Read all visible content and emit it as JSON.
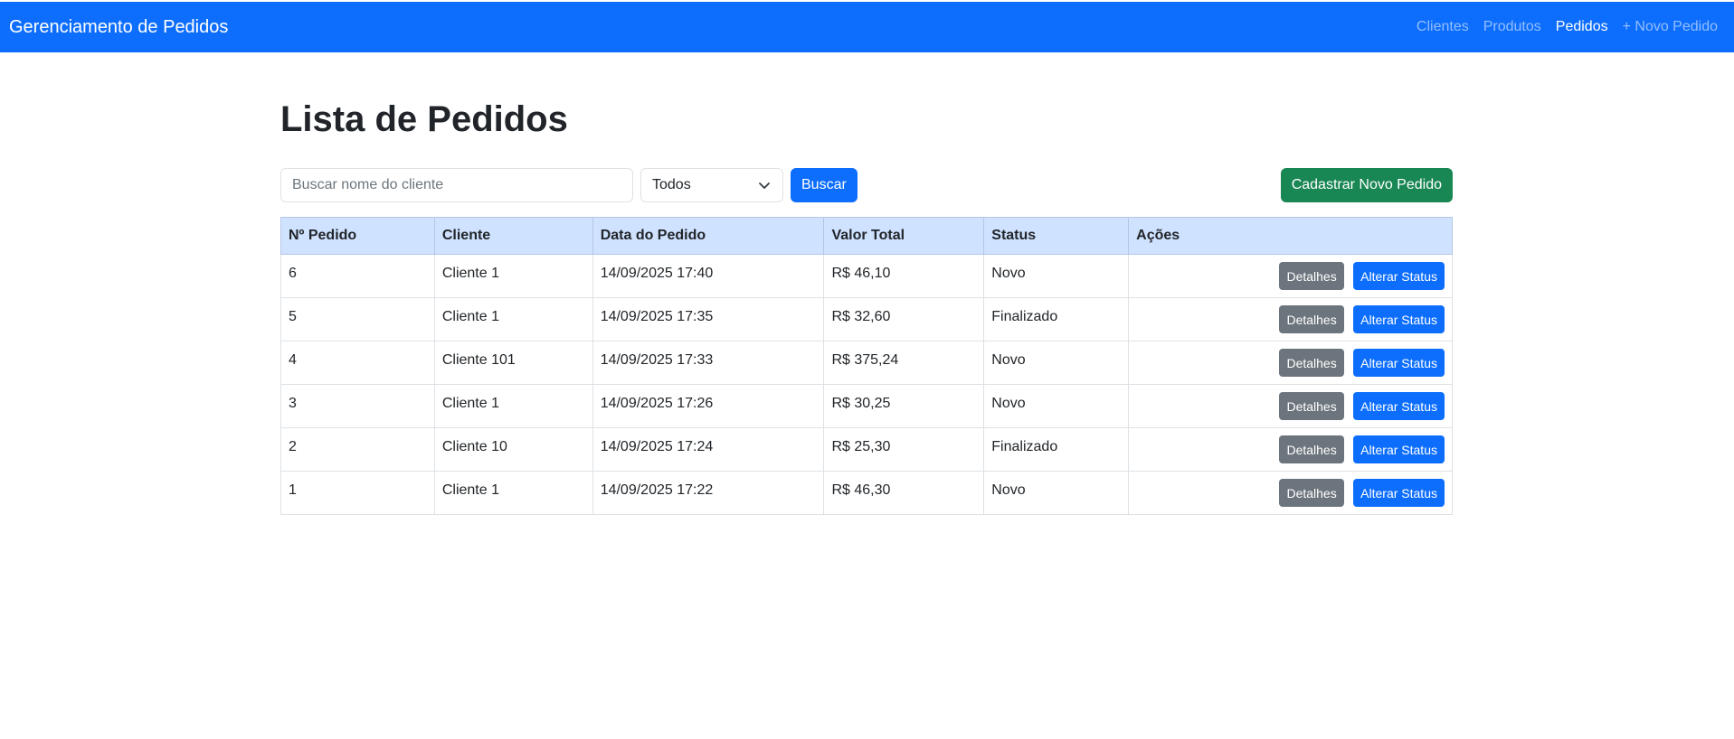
{
  "navbar": {
    "brand": "Gerenciamento de Pedidos",
    "links": [
      {
        "label": "Clientes",
        "active": false
      },
      {
        "label": "Produtos",
        "active": false
      },
      {
        "label": "Pedidos",
        "active": true
      },
      {
        "label": "+ Novo Pedido",
        "active": false
      }
    ]
  },
  "page": {
    "title": "Lista de Pedidos"
  },
  "toolbar": {
    "search_placeholder": "Buscar nome do cliente",
    "search_value": "",
    "status_filter": "Todos",
    "search_button": "Buscar",
    "new_order_button": "Cadastrar Novo Pedido"
  },
  "table": {
    "headers": [
      "Nº Pedido",
      "Cliente",
      "Data do Pedido",
      "Valor Total",
      "Status",
      "Ações"
    ],
    "rows": [
      {
        "id": "6",
        "client": "Cliente 1",
        "date": "14/09/2025 17:40",
        "total": "R$ 46,10",
        "status": "Novo"
      },
      {
        "id": "5",
        "client": "Cliente 1",
        "date": "14/09/2025 17:35",
        "total": "R$ 32,60",
        "status": "Finalizado"
      },
      {
        "id": "4",
        "client": "Cliente 101",
        "date": "14/09/2025 17:33",
        "total": "R$ 375,24",
        "status": "Novo"
      },
      {
        "id": "3",
        "client": "Cliente 1",
        "date": "14/09/2025 17:26",
        "total": "R$ 30,25",
        "status": "Novo"
      },
      {
        "id": "2",
        "client": "Cliente 10",
        "date": "14/09/2025 17:24",
        "total": "R$ 25,30",
        "status": "Finalizado"
      },
      {
        "id": "1",
        "client": "Cliente 1",
        "date": "14/09/2025 17:22",
        "total": "R$ 46,30",
        "status": "Novo"
      }
    ],
    "details_label": "Detalhes",
    "change_status_label": "Alterar Status"
  },
  "colors": {
    "primary": "#0d6efd",
    "success": "#198754",
    "secondary": "#6c757d",
    "table_header": "#cfe2ff"
  },
  "icons": {
    "select_arrow": "chevron-down-icon"
  }
}
